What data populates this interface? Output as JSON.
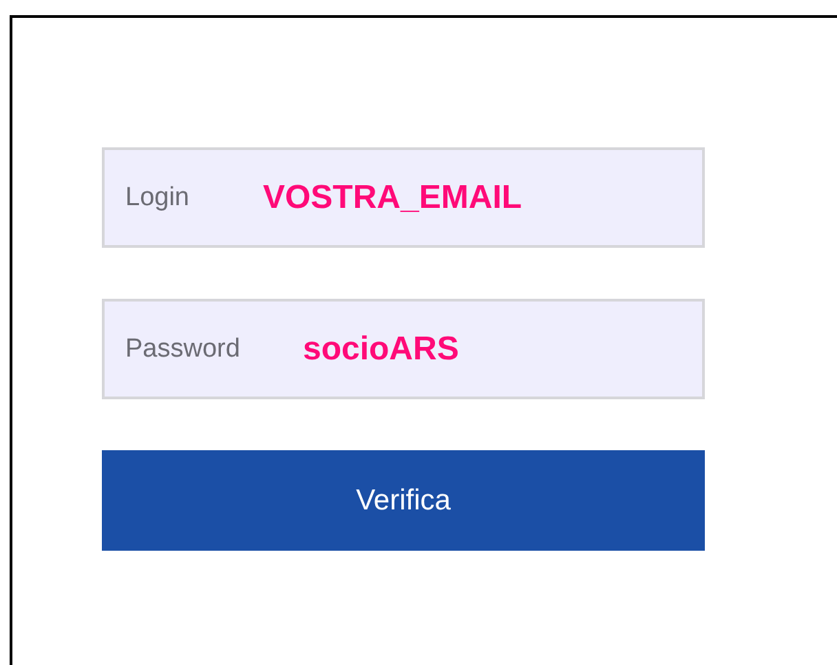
{
  "fields": [
    {
      "label": "Login",
      "value": "VOSTRA_EMAIL"
    },
    {
      "label": "Password",
      "value": "socioARS"
    }
  ],
  "button": {
    "label": "Verifica"
  }
}
